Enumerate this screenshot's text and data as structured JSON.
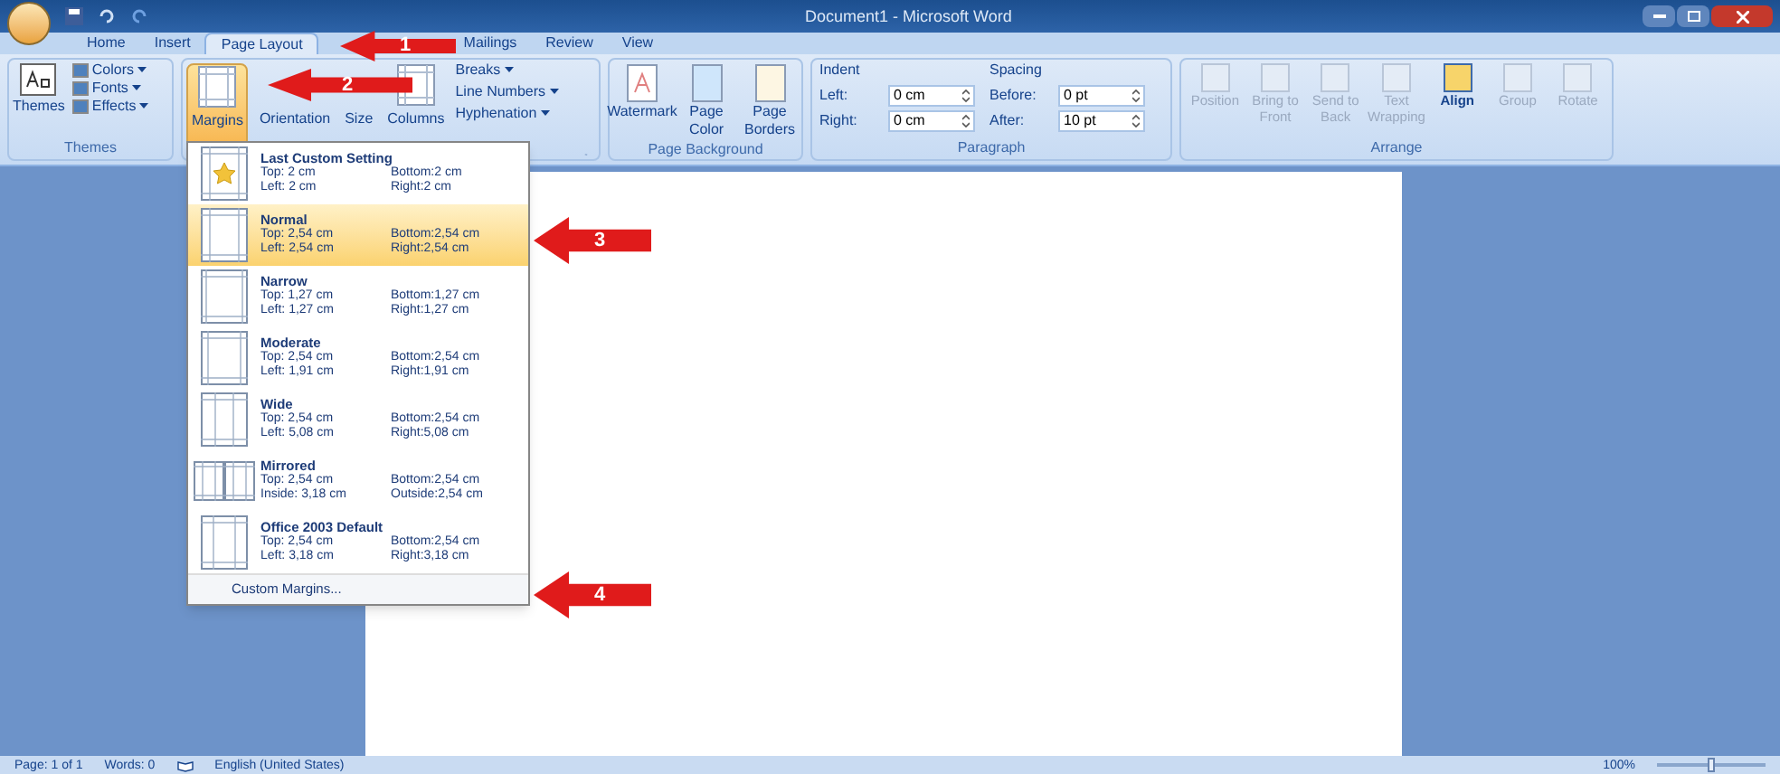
{
  "window": {
    "title": "Document1 - Microsoft Word"
  },
  "tabs": [
    {
      "label": "Home",
      "selected": false
    },
    {
      "label": "Insert",
      "selected": false
    },
    {
      "label": "Page Layout",
      "selected": true
    },
    {
      "label": "Mailings",
      "selected": false
    },
    {
      "label": "Review",
      "selected": false
    },
    {
      "label": "View",
      "selected": false
    }
  ],
  "themes_group": {
    "label": "Themes",
    "big": "Themes",
    "small": [
      "Colors",
      "Fonts",
      "Effects"
    ]
  },
  "page_setup": {
    "big": [
      {
        "label": "Margins",
        "pressed": true
      },
      {
        "label": "Orientation",
        "pressed": false
      },
      {
        "label": "Size",
        "pressed": false
      },
      {
        "label": "Columns",
        "pressed": false
      }
    ],
    "small": [
      "Breaks",
      "Line Numbers",
      "Hyphenation"
    ]
  },
  "page_background": {
    "label": "Page Background",
    "buttons": [
      {
        "label": "Watermark",
        "kind": "watermark"
      },
      {
        "label": "Page Color",
        "kind": "color"
      },
      {
        "label": "Page Borders",
        "kind": "borders"
      }
    ]
  },
  "paragraph": {
    "label": "Paragraph",
    "indent": {
      "title": "Indent",
      "rows": [
        {
          "label": "Left:",
          "value": "0 cm"
        },
        {
          "label": "Right:",
          "value": "0 cm"
        }
      ]
    },
    "spacing": {
      "title": "Spacing",
      "rows": [
        {
          "label": "Before:",
          "value": "0 pt"
        },
        {
          "label": "After:",
          "value": "10 pt"
        }
      ]
    }
  },
  "arrange": {
    "label": "Arrange",
    "buttons": [
      {
        "label": "Position",
        "disabled": true
      },
      {
        "label": "Bring to Front",
        "disabled": true
      },
      {
        "label": "Send to Back",
        "disabled": true
      },
      {
        "label": "Text Wrapping",
        "disabled": true
      },
      {
        "label": "Align",
        "disabled": false
      },
      {
        "label": "Group",
        "disabled": true
      },
      {
        "label": "Rotate",
        "disabled": true
      }
    ]
  },
  "margins_menu": {
    "items": [
      {
        "kind": "custom",
        "name": "Last Custom Setting",
        "selected": false,
        "rows": [
          [
            "Top:",
            "2 cm",
            "Bottom:",
            "2 cm"
          ],
          [
            "Left:",
            "2 cm",
            "Right:",
            "2 cm"
          ]
        ]
      },
      {
        "kind": "normal",
        "name": "Normal",
        "selected": true,
        "rows": [
          [
            "Top:",
            "2,54 cm",
            "Bottom:",
            "2,54 cm"
          ],
          [
            "Left:",
            "2,54 cm",
            "Right:",
            "2,54 cm"
          ]
        ]
      },
      {
        "kind": "narrow",
        "name": "Narrow",
        "selected": false,
        "rows": [
          [
            "Top:",
            "1,27 cm",
            "Bottom:",
            "1,27 cm"
          ],
          [
            "Left:",
            "1,27 cm",
            "Right:",
            "1,27 cm"
          ]
        ]
      },
      {
        "kind": "moderate",
        "name": "Moderate",
        "selected": false,
        "rows": [
          [
            "Top:",
            "2,54 cm",
            "Bottom:",
            "2,54 cm"
          ],
          [
            "Left:",
            "1,91 cm",
            "Right:",
            "1,91 cm"
          ]
        ]
      },
      {
        "kind": "wide",
        "name": "Wide",
        "selected": false,
        "rows": [
          [
            "Top:",
            "2,54 cm",
            "Bottom:",
            "2,54 cm"
          ],
          [
            "Left:",
            "5,08 cm",
            "Right:",
            "5,08 cm"
          ]
        ]
      },
      {
        "kind": "mirrored",
        "name": "Mirrored",
        "selected": false,
        "rows": [
          [
            "Top:",
            "2,54 cm",
            "Bottom:",
            "2,54 cm"
          ],
          [
            "Inside:",
            "3,18 cm",
            "Outside:",
            "2,54 cm"
          ]
        ]
      },
      {
        "kind": "office2003",
        "name": "Office 2003 Default",
        "selected": false,
        "rows": [
          [
            "Top:",
            "2,54 cm",
            "Bottom:",
            "2,54 cm"
          ],
          [
            "Left:",
            "3,18 cm",
            "Right:",
            "3,18 cm"
          ]
        ]
      }
    ],
    "footer": "Custom Margins..."
  },
  "callouts": [
    "1",
    "2",
    "3",
    "4"
  ],
  "status_bar": {
    "page": "Page: 1 of 1",
    "words": "Words: 0",
    "language": "English (United States)",
    "zoom": "100%",
    "zoom_level": {
      "level": 0.5
    }
  }
}
